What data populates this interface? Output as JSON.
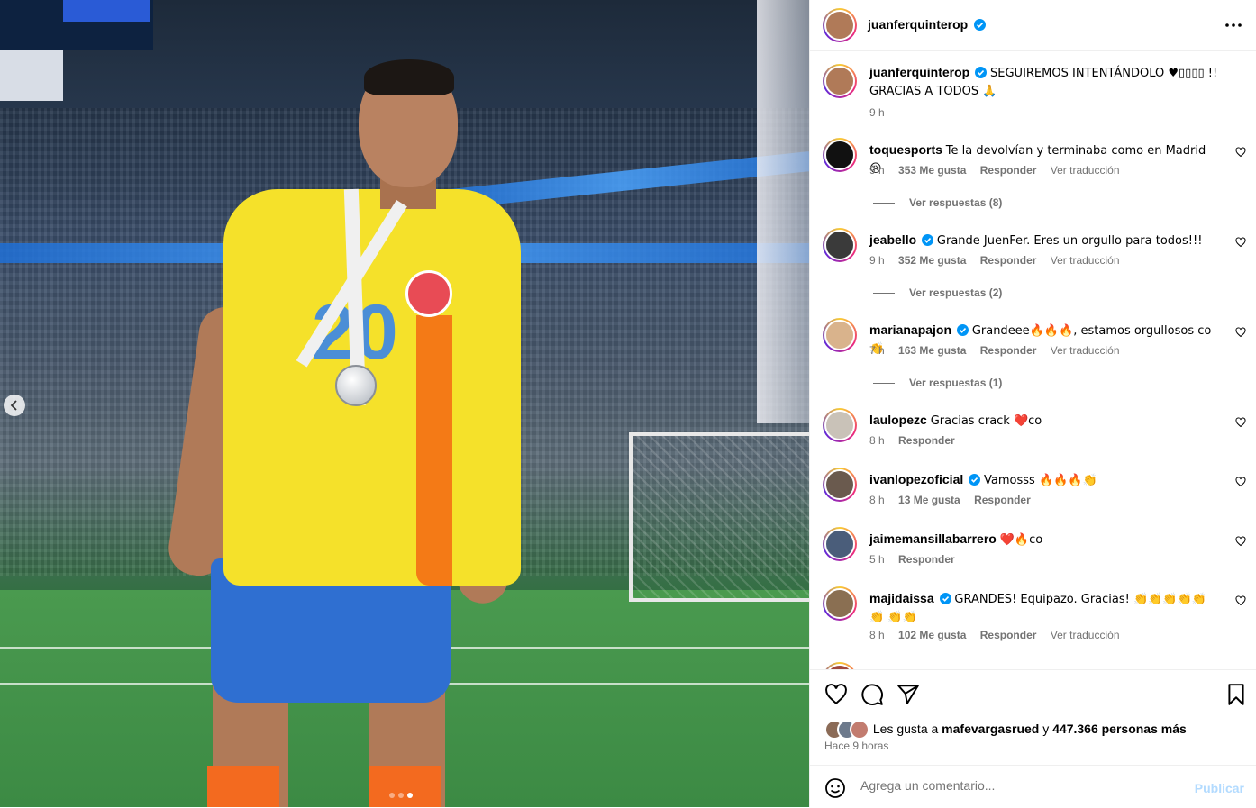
{
  "photo": {
    "carousel_dots": 3,
    "active_dot": 2
  },
  "post": {
    "author": "juanferquinterop",
    "caption_text": "SEGUIREMOS INTENTÁNDOLO ♥▯▯▯▯ !! GRACIAS A TODOS 🙏",
    "caption_time": "9 h"
  },
  "comments": [
    {
      "user": "toquesports",
      "verified": false,
      "text": "Te la devolvían y terminaba como en Madrid 😢",
      "time": "9 h",
      "likes": "353 Me gusta",
      "reply": "Responder",
      "translate": "Ver traducción",
      "replies": "Ver respuestas (8)",
      "avatar_color": "#111111"
    },
    {
      "user": "jeabello",
      "verified": true,
      "text": "Grande JuenFer. Eres un orgullo para todos!!!",
      "time": "9 h",
      "likes": "352 Me gusta",
      "reply": "Responder",
      "translate": "Ver traducción",
      "replies": "Ver respuestas (2)",
      "avatar_color": "#3a3a3a"
    },
    {
      "user": "marianapajon",
      "verified": true,
      "text": "Grandeee🔥🔥🔥, estamos orgullosos co👏",
      "time": "7 h",
      "likes": "163 Me gusta",
      "reply": "Responder",
      "translate": "Ver traducción",
      "replies": "Ver respuestas (1)",
      "avatar_color": "#d9b38c"
    },
    {
      "user": "laulopezc",
      "verified": false,
      "text": "Gracias crack ❤️co",
      "time": "8 h",
      "likes": "",
      "reply": "Responder",
      "translate": "",
      "replies": "",
      "avatar_color": "#c9c2b8"
    },
    {
      "user": "ivanlopezoficial",
      "verified": true,
      "text": "Vamosss 🔥🔥🔥👏",
      "time": "8 h",
      "likes": "13 Me gusta",
      "reply": "Responder",
      "translate": "",
      "replies": "",
      "avatar_color": "#6a5a4e"
    },
    {
      "user": "jaimemansillabarrero",
      "verified": false,
      "text": "❤️🔥co",
      "time": "5 h",
      "likes": "",
      "reply": "Responder",
      "translate": "",
      "replies": "",
      "avatar_color": "#4a5d7a"
    },
    {
      "user": "majidaissa",
      "verified": true,
      "text": "GRANDES! Equipazo. Gracias! 👏👏👏👏👏👏 👏👏",
      "time": "8 h",
      "likes": "102 Me gusta",
      "reply": "Responder",
      "translate": "Ver traducción",
      "replies": "",
      "avatar_color": "#8a6f52"
    }
  ],
  "likes": {
    "prefix": "Les gusta a",
    "user": "mafevargasrued",
    "conj": "y",
    "others": "447.366 personas más"
  },
  "posted": "Hace 9 horas",
  "add_comment": {
    "placeholder": "Agrega un comentario...",
    "publish": "Publicar"
  },
  "icons": {
    "like": "heart-icon",
    "comment": "comment-icon",
    "share": "share-icon",
    "save": "bookmark-icon",
    "emoji": "emoji-icon",
    "more": "more-icon"
  },
  "colors": {
    "verified": "#0095f6",
    "muted": "#737373",
    "publish_disabled": "#b3dbff"
  }
}
